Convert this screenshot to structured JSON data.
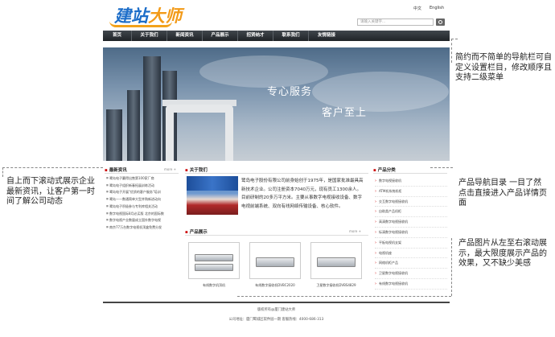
{
  "header": {
    "logo": {
      "part1": "建站",
      "part2": "大师"
    },
    "lang_zh": "中文",
    "lang_en": "English",
    "search_placeholder": "请输入关键字..."
  },
  "nav": {
    "items": [
      {
        "label": "首页"
      },
      {
        "label": "关于我们"
      },
      {
        "label": "新闻资讯"
      },
      {
        "label": "产品展示"
      },
      {
        "label": "招贤纳才"
      },
      {
        "label": "联系我们"
      },
      {
        "label": "友情链接"
      }
    ]
  },
  "banner": {
    "slogan1": "专心服务",
    "slogan2": "客户至上"
  },
  "news": {
    "heading": "最新资讯",
    "more": "more +",
    "items": [
      "鹭岛电子赢得出售第100家厂商",
      "鹭岛电子组织新春拓展训练活动",
      "鹭岛电子开展\"优质的客户服务\"培训",
      "鹭岛——数通简单大型并购新进动向",
      "鹭岛电子积极参与专利库相关活动",
      "数字电视国际8月必买版 北京的国际数",
      "数字电视产业数量成立国外数字电视",
      "南京77万台数字电视机顶盒免费分发"
    ]
  },
  "about": {
    "heading": "关于我们",
    "text": "鹭岛电子股份有限公司前身始创于1975年，是国家批准最具高新技术企业。公司注册资本7040万元，现有员工1300余人。目前研制的20多万平方米。主要从事数字电视接收设备、数字电视前端系统、双向有线网络传输设备、核心软件。"
  },
  "categories": {
    "heading": "产品分类",
    "items": [
      "数字电视接收机",
      "ATM机系统机柜",
      "交互数字电视接收机",
      "自助类产品机柜",
      "高清数字电视接收机",
      "标清数字电视接收机",
      "平板电视机支架",
      "电视机座",
      "网络机柜产品",
      "卫星数字电视接收机",
      "有线数字电视接收机"
    ]
  },
  "products": {
    "heading": "产品展示",
    "more": "more +",
    "items": [
      {
        "caption": "有线数字机顶机"
      },
      {
        "caption": "有线数字接收机DVBC2020"
      },
      {
        "caption": "卫星数字接收机DVBS4829"
      }
    ]
  },
  "footer": {
    "copyright": "版权所有@厦门建站大师",
    "address": "公司地址：厦门鹭城区软件园一期 客服热线：4000-686-313"
  },
  "callouts": {
    "nav": "简约而不简单的导航栏可自定义设置栏目，修改顺序且支持二级菜单",
    "news": "自上而下滚动式展示企业最新资讯，让客户第一时间了解公司动态",
    "categories": "产品导航目录 一目了然 点击直接进入产品详情页面",
    "products": "产品图片从左至右滚动展示，最大限度展示产品的效果，又不缺少美感"
  }
}
